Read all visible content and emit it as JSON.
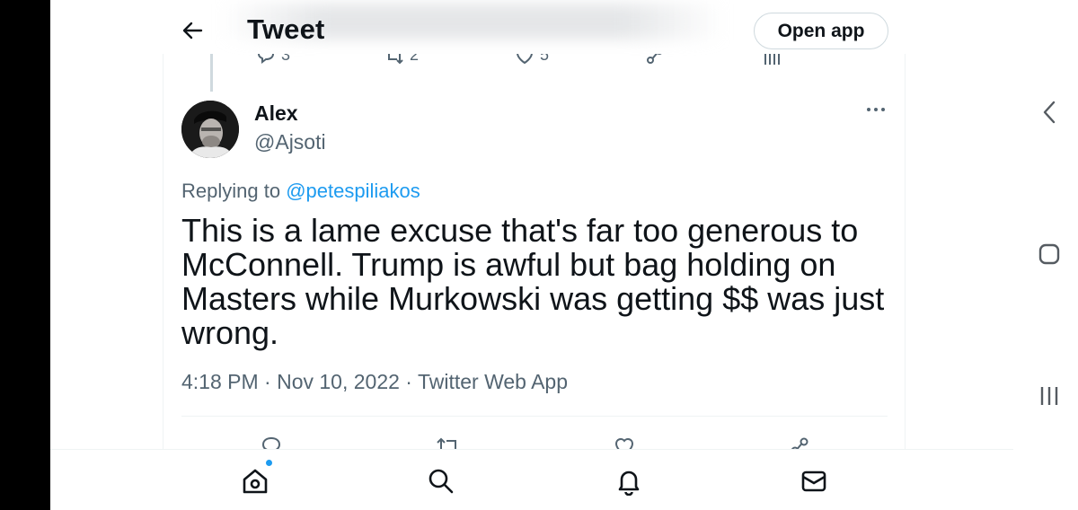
{
  "header": {
    "title": "Tweet",
    "open_app_label": "Open app"
  },
  "previous_tweet_actions": {
    "reply_count": "3",
    "retweet_count": "2",
    "like_count": "5"
  },
  "tweet": {
    "author_name": "Alex",
    "author_handle": "@Ajsoti",
    "replying_prefix": "Replying to",
    "replying_to": "@petespiliakos",
    "text": "This is a lame excuse that's far too generous to McConnell. Trump is awful but bag holding on Masters while Murkowski was getting $$ was just wrong.",
    "timestamp": "4:18 PM · Nov 10, 2022 · ",
    "source": "Twitter Web App"
  },
  "icons": {
    "back": "arrow-left-icon",
    "more": "more-dots-icon",
    "reply": "reply-icon",
    "retweet": "retweet-icon",
    "like": "heart-icon",
    "share": "share-icon",
    "home": "home-icon",
    "search": "search-icon",
    "notifications": "bell-icon",
    "messages": "mail-icon"
  },
  "colors": {
    "accent": "#1d9bf0",
    "text_primary": "#0f1419",
    "text_secondary": "#536471"
  }
}
